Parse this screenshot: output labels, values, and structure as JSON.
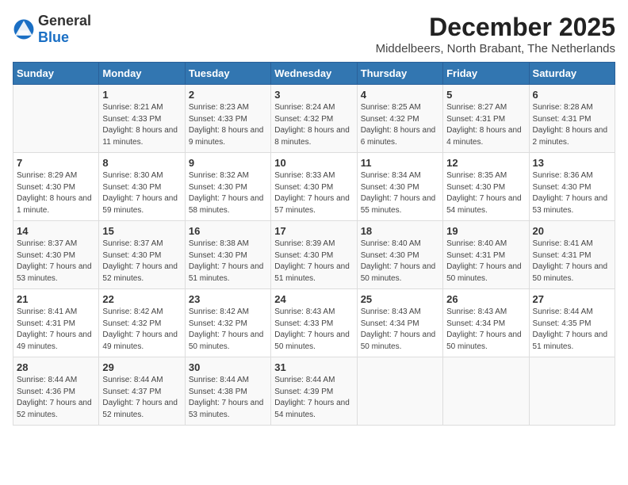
{
  "header": {
    "logo_general": "General",
    "logo_blue": "Blue",
    "main_title": "December 2025",
    "subtitle": "Middelbeers, North Brabant, The Netherlands"
  },
  "days": [
    "Sunday",
    "Monday",
    "Tuesday",
    "Wednesday",
    "Thursday",
    "Friday",
    "Saturday"
  ],
  "weeks": [
    [
      {
        "date": "",
        "sunrise": "",
        "sunset": "",
        "daylight": ""
      },
      {
        "date": "1",
        "sunrise": "Sunrise: 8:21 AM",
        "sunset": "Sunset: 4:33 PM",
        "daylight": "Daylight: 8 hours and 11 minutes."
      },
      {
        "date": "2",
        "sunrise": "Sunrise: 8:23 AM",
        "sunset": "Sunset: 4:33 PM",
        "daylight": "Daylight: 8 hours and 9 minutes."
      },
      {
        "date": "3",
        "sunrise": "Sunrise: 8:24 AM",
        "sunset": "Sunset: 4:32 PM",
        "daylight": "Daylight: 8 hours and 8 minutes."
      },
      {
        "date": "4",
        "sunrise": "Sunrise: 8:25 AM",
        "sunset": "Sunset: 4:32 PM",
        "daylight": "Daylight: 8 hours and 6 minutes."
      },
      {
        "date": "5",
        "sunrise": "Sunrise: 8:27 AM",
        "sunset": "Sunset: 4:31 PM",
        "daylight": "Daylight: 8 hours and 4 minutes."
      },
      {
        "date": "6",
        "sunrise": "Sunrise: 8:28 AM",
        "sunset": "Sunset: 4:31 PM",
        "daylight": "Daylight: 8 hours and 2 minutes."
      }
    ],
    [
      {
        "date": "7",
        "sunrise": "Sunrise: 8:29 AM",
        "sunset": "Sunset: 4:30 PM",
        "daylight": "Daylight: 8 hours and 1 minute."
      },
      {
        "date": "8",
        "sunrise": "Sunrise: 8:30 AM",
        "sunset": "Sunset: 4:30 PM",
        "daylight": "Daylight: 7 hours and 59 minutes."
      },
      {
        "date": "9",
        "sunrise": "Sunrise: 8:32 AM",
        "sunset": "Sunset: 4:30 PM",
        "daylight": "Daylight: 7 hours and 58 minutes."
      },
      {
        "date": "10",
        "sunrise": "Sunrise: 8:33 AM",
        "sunset": "Sunset: 4:30 PM",
        "daylight": "Daylight: 7 hours and 57 minutes."
      },
      {
        "date": "11",
        "sunrise": "Sunrise: 8:34 AM",
        "sunset": "Sunset: 4:30 PM",
        "daylight": "Daylight: 7 hours and 55 minutes."
      },
      {
        "date": "12",
        "sunrise": "Sunrise: 8:35 AM",
        "sunset": "Sunset: 4:30 PM",
        "daylight": "Daylight: 7 hours and 54 minutes."
      },
      {
        "date": "13",
        "sunrise": "Sunrise: 8:36 AM",
        "sunset": "Sunset: 4:30 PM",
        "daylight": "Daylight: 7 hours and 53 minutes."
      }
    ],
    [
      {
        "date": "14",
        "sunrise": "Sunrise: 8:37 AM",
        "sunset": "Sunset: 4:30 PM",
        "daylight": "Daylight: 7 hours and 53 minutes."
      },
      {
        "date": "15",
        "sunrise": "Sunrise: 8:37 AM",
        "sunset": "Sunset: 4:30 PM",
        "daylight": "Daylight: 7 hours and 52 minutes."
      },
      {
        "date": "16",
        "sunrise": "Sunrise: 8:38 AM",
        "sunset": "Sunset: 4:30 PM",
        "daylight": "Daylight: 7 hours and 51 minutes."
      },
      {
        "date": "17",
        "sunrise": "Sunrise: 8:39 AM",
        "sunset": "Sunset: 4:30 PM",
        "daylight": "Daylight: 7 hours and 51 minutes."
      },
      {
        "date": "18",
        "sunrise": "Sunrise: 8:40 AM",
        "sunset": "Sunset: 4:30 PM",
        "daylight": "Daylight: 7 hours and 50 minutes."
      },
      {
        "date": "19",
        "sunrise": "Sunrise: 8:40 AM",
        "sunset": "Sunset: 4:31 PM",
        "daylight": "Daylight: 7 hours and 50 minutes."
      },
      {
        "date": "20",
        "sunrise": "Sunrise: 8:41 AM",
        "sunset": "Sunset: 4:31 PM",
        "daylight": "Daylight: 7 hours and 50 minutes."
      }
    ],
    [
      {
        "date": "21",
        "sunrise": "Sunrise: 8:41 AM",
        "sunset": "Sunset: 4:31 PM",
        "daylight": "Daylight: 7 hours and 49 minutes."
      },
      {
        "date": "22",
        "sunrise": "Sunrise: 8:42 AM",
        "sunset": "Sunset: 4:32 PM",
        "daylight": "Daylight: 7 hours and 49 minutes."
      },
      {
        "date": "23",
        "sunrise": "Sunrise: 8:42 AM",
        "sunset": "Sunset: 4:32 PM",
        "daylight": "Daylight: 7 hours and 50 minutes."
      },
      {
        "date": "24",
        "sunrise": "Sunrise: 8:43 AM",
        "sunset": "Sunset: 4:33 PM",
        "daylight": "Daylight: 7 hours and 50 minutes."
      },
      {
        "date": "25",
        "sunrise": "Sunrise: 8:43 AM",
        "sunset": "Sunset: 4:34 PM",
        "daylight": "Daylight: 7 hours and 50 minutes."
      },
      {
        "date": "26",
        "sunrise": "Sunrise: 8:43 AM",
        "sunset": "Sunset: 4:34 PM",
        "daylight": "Daylight: 7 hours and 50 minutes."
      },
      {
        "date": "27",
        "sunrise": "Sunrise: 8:44 AM",
        "sunset": "Sunset: 4:35 PM",
        "daylight": "Daylight: 7 hours and 51 minutes."
      }
    ],
    [
      {
        "date": "28",
        "sunrise": "Sunrise: 8:44 AM",
        "sunset": "Sunset: 4:36 PM",
        "daylight": "Daylight: 7 hours and 52 minutes."
      },
      {
        "date": "29",
        "sunrise": "Sunrise: 8:44 AM",
        "sunset": "Sunset: 4:37 PM",
        "daylight": "Daylight: 7 hours and 52 minutes."
      },
      {
        "date": "30",
        "sunrise": "Sunrise: 8:44 AM",
        "sunset": "Sunset: 4:38 PM",
        "daylight": "Daylight: 7 hours and 53 minutes."
      },
      {
        "date": "31",
        "sunrise": "Sunrise: 8:44 AM",
        "sunset": "Sunset: 4:39 PM",
        "daylight": "Daylight: 7 hours and 54 minutes."
      },
      {
        "date": "",
        "sunrise": "",
        "sunset": "",
        "daylight": ""
      },
      {
        "date": "",
        "sunrise": "",
        "sunset": "",
        "daylight": ""
      },
      {
        "date": "",
        "sunrise": "",
        "sunset": "",
        "daylight": ""
      }
    ]
  ]
}
